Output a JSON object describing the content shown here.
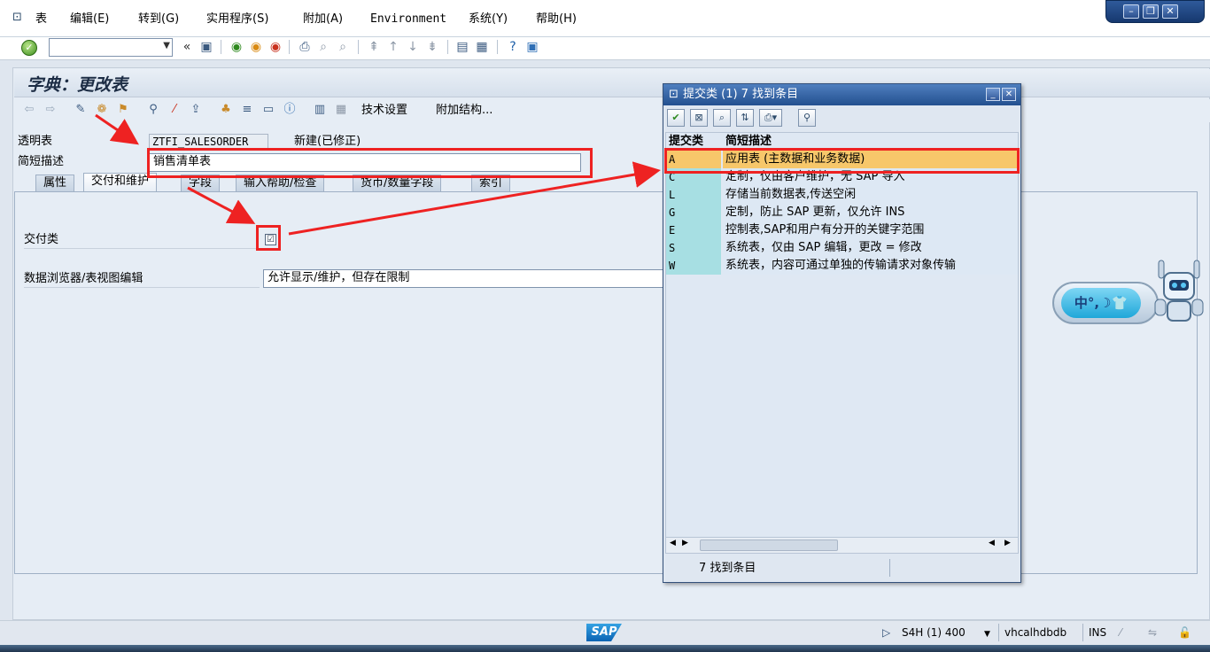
{
  "menu": {
    "items": [
      "表",
      "编辑(E)",
      "转到(G)",
      "实用程序(S)",
      "附加(A)",
      "Environment",
      "系统(Y)",
      "帮助(H)"
    ]
  },
  "toolbar": {
    "command_value": "",
    "back_symbol": "«"
  },
  "page": {
    "title": "字典：更改表"
  },
  "app_toolbar": {
    "tech_settings": "技术设置",
    "append_structure": "附加结构..."
  },
  "form": {
    "transparent_table_label": "透明表",
    "table_name": "ZTFI_SALESORDER",
    "status": "新建(已修正)",
    "short_desc_label": "简短描述",
    "short_desc_value": "销售清单表"
  },
  "tabs": [
    "属性",
    "交付和维护",
    "字段",
    "输入帮助/检查",
    "货币/数量字段",
    "索引"
  ],
  "delivery": {
    "delivery_class_label": "交付类",
    "delivery_class_checked": true,
    "browser_label": "数据浏览器/表视图编辑",
    "browser_value": "允许显示/维护，但存在限制"
  },
  "dialog": {
    "title": "提交类 (1)    7 找到条目",
    "col_key": "提交类",
    "col_desc": "简短描述",
    "rows": [
      {
        "key": "A",
        "desc": "应用表 (主数据和业务数据)"
      },
      {
        "key": "C",
        "desc": "定制，仅由客户维护，无 SAP 导入"
      },
      {
        "key": "L",
        "desc": "存储当前数据表,传送空闲"
      },
      {
        "key": "G",
        "desc": "定制，防止 SAP 更新，仅允许 INS"
      },
      {
        "key": "E",
        "desc": "控制表,SAP和用户有分开的关键字范围"
      },
      {
        "key": "S",
        "desc": "系统表，仅由 SAP 编辑，更改 = 修改"
      },
      {
        "key": "W",
        "desc": "系统表，内容可通过单独的传输请求对象传输"
      }
    ],
    "selected_index": 0,
    "status": "7 找到条目"
  },
  "ime": {
    "text": "中°,☽👕"
  },
  "statusbar": {
    "logo": "SAP",
    "system": "S4H (1) 400",
    "host": "vhcalhdbdb",
    "mode": "INS"
  },
  "colors": {
    "selection": "#f7c76a",
    "key_column": "#a7dfe3",
    "annotation_red": "#ee2222",
    "dialog_title": "#23508f"
  },
  "icons": [
    "table-icon",
    "ok-icon",
    "save-icon",
    "back-icon",
    "exit-icon",
    "cancel-icon",
    "print-icon",
    "find-icon",
    "help-icon",
    "customize-icon"
  ]
}
